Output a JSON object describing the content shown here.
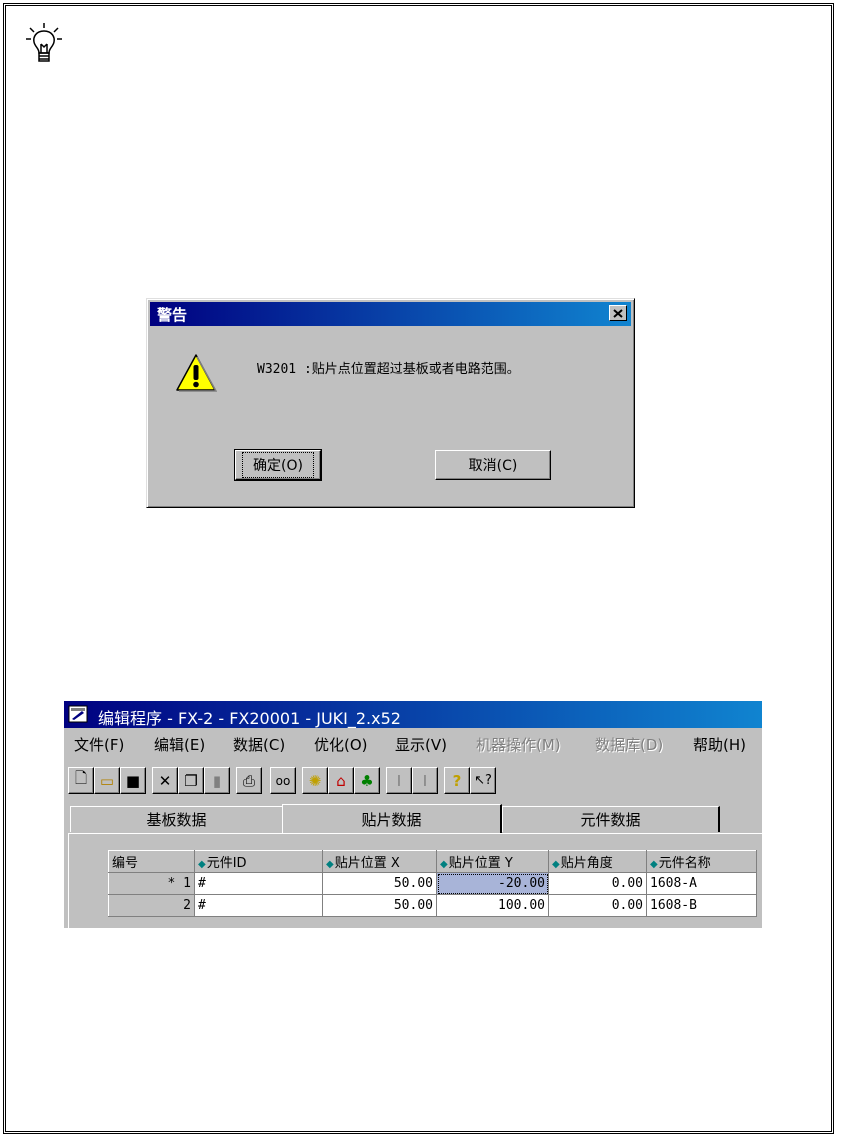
{
  "dialog": {
    "title": "警告",
    "close_glyph": "✕",
    "message": "W3201 :贴片点位置超过基板或者电路范围。",
    "ok_label": "确定(O)",
    "cancel_label": "取消(C)",
    "icon": "warning-icon"
  },
  "app": {
    "title": "编辑程序 - FX-2 - FX20001 - JUKI_2.x52",
    "menu": [
      {
        "label": "文件(F)",
        "enabled": true
      },
      {
        "label": "编辑(E)",
        "enabled": true
      },
      {
        "label": "数据(C)",
        "enabled": true
      },
      {
        "label": "优化(O)",
        "enabled": true
      },
      {
        "label": "显示(V)",
        "enabled": true
      },
      {
        "label": "机器操作(M)",
        "enabled": false
      },
      {
        "label": "数据库(D)",
        "enabled": false
      },
      {
        "label": "帮助(H)",
        "enabled": true
      }
    ],
    "tabs": [
      "基板数据",
      "贴片数据",
      "元件数据"
    ],
    "active_tab": "贴片数据",
    "grid": {
      "headers": [
        "编号",
        "元件ID",
        "贴片位置 X",
        "贴片位置 Y",
        "贴片角度",
        "元件名称"
      ],
      "rows": [
        {
          "no": "* 1",
          "id": "#",
          "x": "50.00",
          "y": "-20.00",
          "angle": "0.00",
          "name": "1608-A"
        },
        {
          "no": "2",
          "id": "#",
          "x": "50.00",
          "y": "100.00",
          "angle": "0.00",
          "name": "1608-B"
        }
      ]
    }
  },
  "colors": {
    "titlebar": "#000080",
    "face": "#c0c0c0",
    "selected_cell": "#a8b4d8"
  }
}
